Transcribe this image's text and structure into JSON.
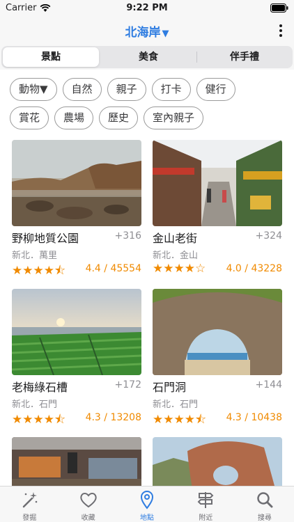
{
  "status_bar": {
    "carrier": "Carrier",
    "time": "9:22 PM"
  },
  "nav": {
    "title": "北海岸",
    "caret": "▼"
  },
  "segments": [
    {
      "label": "景點",
      "active": true
    },
    {
      "label": "美食",
      "active": false
    },
    {
      "label": "伴手禮",
      "active": false
    }
  ],
  "filters": {
    "row1": [
      "動物▼",
      "自然",
      "親子",
      "打卡",
      "健行"
    ],
    "row2": [
      "賞花",
      "農場",
      "歷史",
      "室內親子"
    ]
  },
  "places": [
    {
      "name": "野柳地質公園",
      "count": "+316",
      "location": "新北．萬里",
      "stars": "★★★★⯪",
      "rating": "4.4 / 45554"
    },
    {
      "name": "金山老街",
      "count": "+324",
      "location": "新北．金山",
      "stars": "★★★★☆",
      "rating": "4.0 / 43228"
    },
    {
      "name": "老梅綠石槽",
      "count": "+172",
      "location": "新北．石門",
      "stars": "★★★★⯪",
      "rating": "4.3 / 13208"
    },
    {
      "name": "石門洞",
      "count": "+144",
      "location": "新北．石門",
      "stars": "★★★★⯪",
      "rating": "4.3 / 10438"
    }
  ],
  "tabs": [
    {
      "label": "發掘",
      "icon": "magic-wand-icon"
    },
    {
      "label": "收藏",
      "icon": "heart-icon"
    },
    {
      "label": "地點",
      "icon": "map-pin-icon"
    },
    {
      "label": "附近",
      "icon": "signpost-icon"
    },
    {
      "label": "搜尋",
      "icon": "search-icon"
    }
  ],
  "colors": {
    "accent": "#2f7de1",
    "star": "#f08a00",
    "muted": "#8e8e93"
  }
}
